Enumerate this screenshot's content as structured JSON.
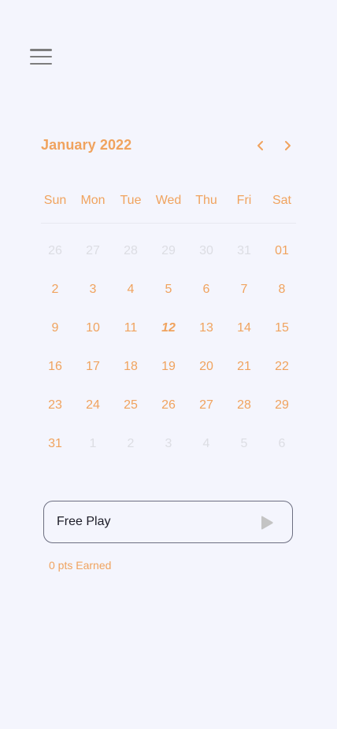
{
  "calendar": {
    "month_label": "January 2022",
    "weekdays": [
      "Sun",
      "Mon",
      "Tue",
      "Wed",
      "Thu",
      "Fri",
      "Sat"
    ],
    "weeks": [
      [
        {
          "d": "26",
          "m": true
        },
        {
          "d": "27",
          "m": true
        },
        {
          "d": "28",
          "m": true
        },
        {
          "d": "29",
          "m": true
        },
        {
          "d": "30",
          "m": true
        },
        {
          "d": "31",
          "m": true
        },
        {
          "d": "01",
          "m": false
        }
      ],
      [
        {
          "d": "2",
          "m": false
        },
        {
          "d": "3",
          "m": false
        },
        {
          "d": "4",
          "m": false
        },
        {
          "d": "5",
          "m": false
        },
        {
          "d": "6",
          "m": false
        },
        {
          "d": "7",
          "m": false
        },
        {
          "d": "8",
          "m": false
        }
      ],
      [
        {
          "d": "9",
          "m": false
        },
        {
          "d": "10",
          "m": false
        },
        {
          "d": "11",
          "m": false
        },
        {
          "d": "12",
          "m": false,
          "today": true
        },
        {
          "d": "13",
          "m": false
        },
        {
          "d": "14",
          "m": false
        },
        {
          "d": "15",
          "m": false
        }
      ],
      [
        {
          "d": "16",
          "m": false
        },
        {
          "d": "17",
          "m": false
        },
        {
          "d": "18",
          "m": false
        },
        {
          "d": "19",
          "m": false
        },
        {
          "d": "20",
          "m": false
        },
        {
          "d": "21",
          "m": false
        },
        {
          "d": "22",
          "m": false
        }
      ],
      [
        {
          "d": "23",
          "m": false
        },
        {
          "d": "24",
          "m": false
        },
        {
          "d": "25",
          "m": false
        },
        {
          "d": "26",
          "m": false
        },
        {
          "d": "27",
          "m": false
        },
        {
          "d": "28",
          "m": false
        },
        {
          "d": "29",
          "m": false
        }
      ],
      [
        {
          "d": "31",
          "m": false
        },
        {
          "d": "1",
          "m": true
        },
        {
          "d": "2",
          "m": true
        },
        {
          "d": "3",
          "m": true
        },
        {
          "d": "4",
          "m": true
        },
        {
          "d": "5",
          "m": true
        },
        {
          "d": "6",
          "m": true
        }
      ]
    ]
  },
  "play": {
    "label": "Free Play",
    "icon": "play-icon"
  },
  "points_label": "0 pts Earned",
  "colors": {
    "accent": "#f0a35e",
    "muted": "#dcdde3",
    "background": "#f4f5fd",
    "border": "#6c6e80"
  }
}
